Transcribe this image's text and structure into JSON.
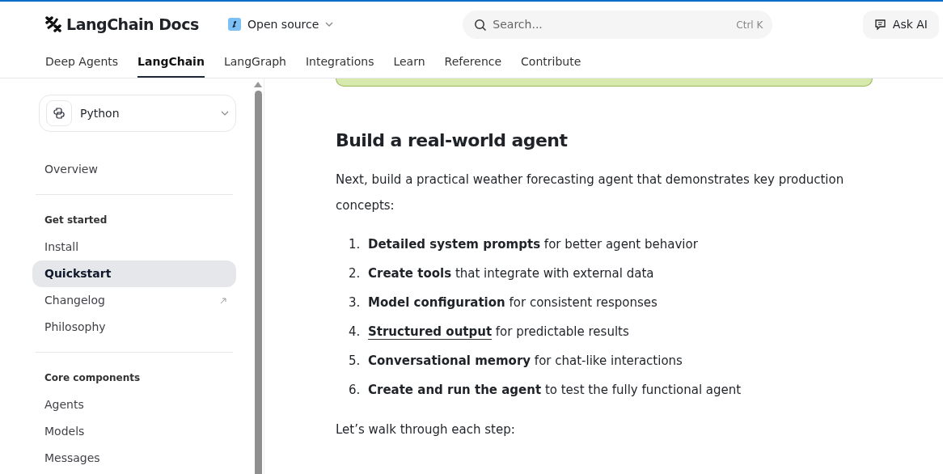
{
  "header": {
    "logo": "LangChain Docs",
    "product_switch": "Open source",
    "search": {
      "placeholder": "Search...",
      "shortcut": "Ctrl K"
    },
    "ask_button": "Ask AI"
  },
  "tabs": [
    {
      "label": "Deep Agents",
      "selected": false
    },
    {
      "label": "LangChain",
      "selected": true
    },
    {
      "label": "LangGraph",
      "selected": false
    },
    {
      "label": "Integrations",
      "selected": false
    },
    {
      "label": "Learn",
      "selected": false
    },
    {
      "label": "Reference",
      "selected": false
    },
    {
      "label": "Contribute",
      "selected": false
    }
  ],
  "sidebar": {
    "language": "Python",
    "sections": [
      {
        "items": [
          {
            "label": "Overview",
            "selected": false,
            "external": false
          }
        ]
      },
      {
        "heading": "Get started",
        "items": [
          {
            "label": "Install",
            "selected": false,
            "external": false
          },
          {
            "label": "Quickstart",
            "selected": true,
            "external": false
          },
          {
            "label": "Changelog",
            "selected": false,
            "external": true
          },
          {
            "label": "Philosophy",
            "selected": false,
            "external": false
          }
        ]
      },
      {
        "heading": "Core components",
        "items": [
          {
            "label": "Agents",
            "selected": false,
            "external": false
          },
          {
            "label": "Models",
            "selected": false,
            "external": false
          },
          {
            "label": "Messages",
            "selected": false,
            "external": false
          }
        ]
      }
    ]
  },
  "content": {
    "heading": "Build a real-world agent",
    "intro": "Next, build a practical weather forecasting agent that demonstrates key production concepts:",
    "steps": [
      {
        "number": "1.",
        "kind": "bold",
        "lead": "Detailed system prompts",
        "rest": " for better agent behavior"
      },
      {
        "number": "2.",
        "kind": "bold",
        "lead": "Create tools",
        "rest": " that integrate with external data"
      },
      {
        "number": "3.",
        "kind": "bold",
        "lead": "Model configuration",
        "rest": " for consistent responses"
      },
      {
        "number": "4.",
        "kind": "link",
        "lead": "Structured output",
        "rest": " for predictable results"
      },
      {
        "number": "5.",
        "kind": "bold",
        "lead": "Conversational memory",
        "rest": " for chat-like interactions"
      },
      {
        "number": "6.",
        "kind": "bold",
        "lead": "Create and run the agent",
        "rest": " to test the fully functional agent"
      }
    ],
    "outro": "Let’s walk through each step:"
  }
}
